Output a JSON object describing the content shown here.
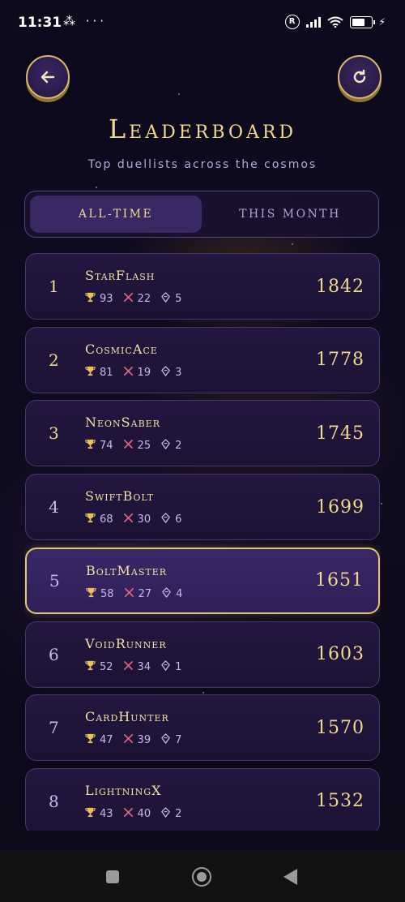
{
  "status_bar": {
    "time": "11:31",
    "left_icons": "⁂ ···",
    "registered_mark": "R"
  },
  "header": {
    "title": "Leaderboard",
    "subtitle": "Top duellists across the cosmos",
    "back_icon": "arrow-left-icon",
    "refresh_icon": "refresh-icon"
  },
  "tabs": [
    {
      "label": "ALL-TIME",
      "active": true
    },
    {
      "label": "THIS MONTH",
      "active": false
    }
  ],
  "players": [
    {
      "rank": "1",
      "name": "StarFlash",
      "wins": "93",
      "losses": "22",
      "streak": "5",
      "score": "1842"
    },
    {
      "rank": "2",
      "name": "CosmicAce",
      "wins": "81",
      "losses": "19",
      "streak": "3",
      "score": "1778"
    },
    {
      "rank": "3",
      "name": "NeonSaber",
      "wins": "74",
      "losses": "25",
      "streak": "2",
      "score": "1745"
    },
    {
      "rank": "4",
      "name": "SwiftBolt",
      "wins": "68",
      "losses": "30",
      "streak": "6",
      "score": "1699"
    },
    {
      "rank": "5",
      "name": "BoltMaster",
      "wins": "58",
      "losses": "27",
      "streak": "4",
      "score": "1651",
      "highlight": true
    },
    {
      "rank": "6",
      "name": "VoidRunner",
      "wins": "52",
      "losses": "34",
      "streak": "1",
      "score": "1603"
    },
    {
      "rank": "7",
      "name": "CardHunter",
      "wins": "47",
      "losses": "39",
      "streak": "7",
      "score": "1570"
    },
    {
      "rank": "8",
      "name": "LightningX",
      "wins": "43",
      "losses": "40",
      "streak": "2",
      "score": "1532"
    }
  ],
  "colors": {
    "gold": "#f0d98c",
    "highlight_border": "#e4c46f",
    "card_bg": "#241640",
    "loss_red": "#e0657a"
  },
  "icons": {
    "wins": "trophy-icon",
    "losses": "cross-icon",
    "streak": "gem-icon"
  }
}
